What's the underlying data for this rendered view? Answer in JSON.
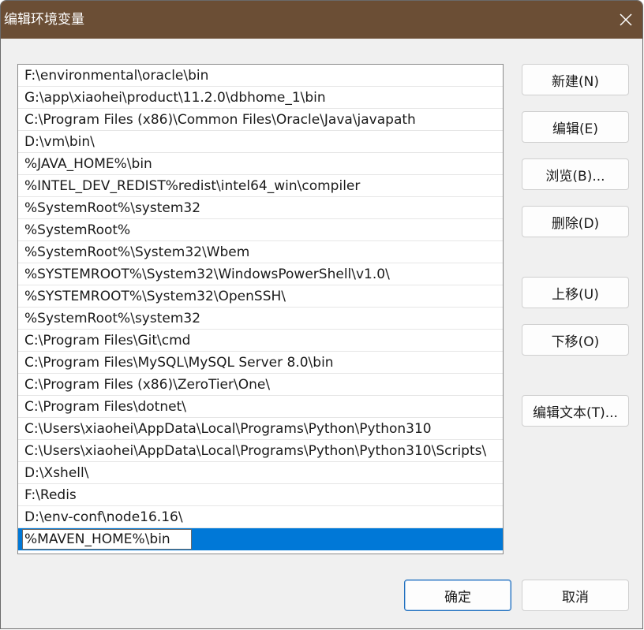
{
  "window": {
    "title": "编辑环境变量"
  },
  "paths": [
    "F:\\environmental\\oracle\\bin",
    "G:\\app\\xiaohei\\product\\11.2.0\\dbhome_1\\bin",
    "C:\\Program Files (x86)\\Common Files\\Oracle\\Java\\javapath",
    "D:\\vm\\bin\\",
    "%JAVA_HOME%\\bin",
    "%INTEL_DEV_REDIST%redist\\intel64_win\\compiler",
    "%SystemRoot%\\system32",
    "%SystemRoot%",
    "%SystemRoot%\\System32\\Wbem",
    "%SYSTEMROOT%\\System32\\WindowsPowerShell\\v1.0\\",
    "%SYSTEMROOT%\\System32\\OpenSSH\\",
    "%SystemRoot%\\system32",
    "C:\\Program Files\\Git\\cmd",
    "C:\\Program Files\\MySQL\\MySQL Server 8.0\\bin",
    "C:\\Program Files (x86)\\ZeroTier\\One\\",
    "C:\\Program Files\\dotnet\\",
    "C:\\Users\\xiaohei\\AppData\\Local\\Programs\\Python\\Python310",
    "C:\\Users\\xiaohei\\AppData\\Local\\Programs\\Python\\Python310\\Scripts\\",
    "D:\\Xshell\\",
    "F:\\Redis",
    "D:\\env-conf\\node16.16\\"
  ],
  "editing": {
    "value": "%MAVEN_HOME%\\bin"
  },
  "buttons": {
    "new": "新建(N)",
    "edit": "编辑(E)",
    "browse": "浏览(B)...",
    "delete": "删除(D)",
    "move_up": "上移(U)",
    "move_down": "下移(O)",
    "edit_text": "编辑文本(T)...",
    "ok": "确定",
    "cancel": "取消"
  },
  "colors": {
    "titlebar": "#6b4e35",
    "selection": "#0078d7"
  },
  "icons": {
    "close": "close-icon"
  }
}
